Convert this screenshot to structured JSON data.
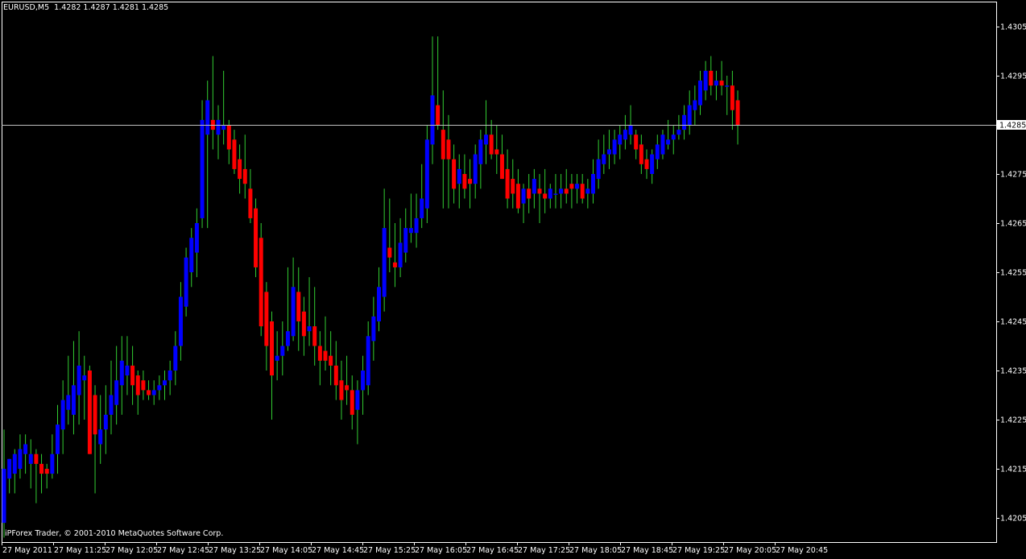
{
  "header": {
    "symbol": "EURUSD,M5",
    "ohlc": "1.4282 1.4287 1.4281 1.4285"
  },
  "footer": {
    "copyright": "iPForex Trader, © 2001-2010 MetaQuotes Software Corp."
  },
  "colors": {
    "background": "#000000",
    "axis": "#ffffff",
    "bull_body": "#0000ff",
    "bear_body": "#ff0000",
    "wick": "#32cd32",
    "price_line": "#c0c0c0"
  },
  "chart_data": {
    "type": "candlestick",
    "title": "EURUSD,M5",
    "y_ticks": [
      "1.4305",
      "1.4295",
      "1.4285",
      "1.4275",
      "1.4265",
      "1.4255",
      "1.4245",
      "1.4235",
      "1.4225",
      "1.4215",
      "1.4205"
    ],
    "x_ticks": [
      "27 May 2011",
      "27 May 11:25",
      "27 May 12:05",
      "27 May 12:45",
      "27 May 13:25",
      "27 May 14:05",
      "27 May 14:45",
      "27 May 15:25",
      "27 May 16:05",
      "27 May 16:45",
      "27 May 17:25",
      "27 May 18:05",
      "27 May 18:45",
      "27 May 19:25",
      "27 May 20:05",
      "27 May 20:45"
    ],
    "current_price": "1.4285",
    "ylim": [
      1.42,
      1.431
    ],
    "candles": [
      {
        "o": 1.4204,
        "h": 1.4223,
        "l": 1.4201,
        "c": 1.4215
      },
      {
        "o": 1.4213,
        "h": 1.4217,
        "l": 1.421,
        "c": 1.4217
      },
      {
        "o": 1.4214,
        "h": 1.4219,
        "l": 1.421,
        "c": 1.4218
      },
      {
        "o": 1.4215,
        "h": 1.4222,
        "l": 1.4213,
        "c": 1.4219
      },
      {
        "o": 1.4218,
        "h": 1.4222,
        "l": 1.4214,
        "c": 1.422
      },
      {
        "o": 1.4216,
        "h": 1.4221,
        "l": 1.4211,
        "c": 1.4218
      },
      {
        "o": 1.4218,
        "h": 1.4219,
        "l": 1.4208,
        "c": 1.4216
      },
      {
        "o": 1.4216,
        "h": 1.4218,
        "l": 1.421,
        "c": 1.4214
      },
      {
        "o": 1.4215,
        "h": 1.4216,
        "l": 1.4211,
        "c": 1.4214
      },
      {
        "o": 1.4214,
        "h": 1.4222,
        "l": 1.4213,
        "c": 1.4218
      },
      {
        "o": 1.4218,
        "h": 1.4228,
        "l": 1.4214,
        "c": 1.4224
      },
      {
        "o": 1.4223,
        "h": 1.4233,
        "l": 1.4218,
        "c": 1.4229
      },
      {
        "o": 1.4227,
        "h": 1.4238,
        "l": 1.4224,
        "c": 1.423
      },
      {
        "o": 1.4226,
        "h": 1.4241,
        "l": 1.4222,
        "c": 1.4232
      },
      {
        "o": 1.423,
        "h": 1.4243,
        "l": 1.4224,
        "c": 1.4236
      },
      {
        "o": 1.4233,
        "h": 1.4238,
        "l": 1.4225,
        "c": 1.4234
      },
      {
        "o": 1.4235,
        "h": 1.4236,
        "l": 1.4218,
        "c": 1.4218
      },
      {
        "o": 1.423,
        "h": 1.4232,
        "l": 1.421,
        "c": 1.4222
      },
      {
        "o": 1.422,
        "h": 1.423,
        "l": 1.4216,
        "c": 1.4223
      },
      {
        "o": 1.4223,
        "h": 1.4232,
        "l": 1.4218,
        "c": 1.4226
      },
      {
        "o": 1.4226,
        "h": 1.4237,
        "l": 1.4222,
        "c": 1.423
      },
      {
        "o": 1.4228,
        "h": 1.424,
        "l": 1.4224,
        "c": 1.4233
      },
      {
        "o": 1.4232,
        "h": 1.4242,
        "l": 1.4226,
        "c": 1.4237
      },
      {
        "o": 1.4234,
        "h": 1.4242,
        "l": 1.423,
        "c": 1.4236
      },
      {
        "o": 1.4236,
        "h": 1.424,
        "l": 1.4228,
        "c": 1.4232
      },
      {
        "o": 1.4234,
        "h": 1.4235,
        "l": 1.4226,
        "c": 1.423
      },
      {
        "o": 1.4233,
        "h": 1.4235,
        "l": 1.4229,
        "c": 1.4231
      },
      {
        "o": 1.4231,
        "h": 1.4233,
        "l": 1.4229,
        "c": 1.423
      },
      {
        "o": 1.423,
        "h": 1.4233,
        "l": 1.4228,
        "c": 1.4231
      },
      {
        "o": 1.4231,
        "h": 1.4234,
        "l": 1.4229,
        "c": 1.4232
      },
      {
        "o": 1.4232,
        "h": 1.4235,
        "l": 1.4229,
        "c": 1.4233
      },
      {
        "o": 1.4233,
        "h": 1.4237,
        "l": 1.423,
        "c": 1.4235
      },
      {
        "o": 1.4235,
        "h": 1.4243,
        "l": 1.4232,
        "c": 1.424
      },
      {
        "o": 1.424,
        "h": 1.4253,
        "l": 1.4237,
        "c": 1.425
      },
      {
        "o": 1.4248,
        "h": 1.426,
        "l": 1.4246,
        "c": 1.4258
      },
      {
        "o": 1.4255,
        "h": 1.4264,
        "l": 1.4252,
        "c": 1.4262
      },
      {
        "o": 1.4259,
        "h": 1.4268,
        "l": 1.4254,
        "c": 1.4265
      },
      {
        "o": 1.4266,
        "h": 1.429,
        "l": 1.4264,
        "c": 1.4286
      },
      {
        "o": 1.4283,
        "h": 1.4294,
        "l": 1.4264,
        "c": 1.429
      },
      {
        "o": 1.4286,
        "h": 1.4299,
        "l": 1.428,
        "c": 1.4284
      },
      {
        "o": 1.4283,
        "h": 1.4289,
        "l": 1.4278,
        "c": 1.4286
      },
      {
        "o": 1.4284,
        "h": 1.4296,
        "l": 1.4281,
        "c": 1.4285
      },
      {
        "o": 1.4285,
        "h": 1.4286,
        "l": 1.4277,
        "c": 1.428
      },
      {
        "o": 1.4282,
        "h": 1.4284,
        "l": 1.4275,
        "c": 1.4276
      },
      {
        "o": 1.4278,
        "h": 1.4281,
        "l": 1.4271,
        "c": 1.4274
      },
      {
        "o": 1.4276,
        "h": 1.4283,
        "l": 1.427,
        "c": 1.4273
      },
      {
        "o": 1.4272,
        "h": 1.4276,
        "l": 1.4265,
        "c": 1.4266
      },
      {
        "o": 1.4268,
        "h": 1.427,
        "l": 1.4254,
        "c": 1.4256
      },
      {
        "o": 1.4262,
        "h": 1.4265,
        "l": 1.4242,
        "c": 1.4244
      },
      {
        "o": 1.4251,
        "h": 1.4253,
        "l": 1.4235,
        "c": 1.424
      },
      {
        "o": 1.4245,
        "h": 1.4247,
        "l": 1.4225,
        "c": 1.4234
      },
      {
        "o": 1.4237,
        "h": 1.4243,
        "l": 1.4233,
        "c": 1.4238
      },
      {
        "o": 1.4238,
        "h": 1.4245,
        "l": 1.4234,
        "c": 1.424
      },
      {
        "o": 1.424,
        "h": 1.4256,
        "l": 1.4239,
        "c": 1.4243
      },
      {
        "o": 1.4242,
        "h": 1.4258,
        "l": 1.4241,
        "c": 1.4252
      },
      {
        "o": 1.4251,
        "h": 1.4256,
        "l": 1.4239,
        "c": 1.4245
      },
      {
        "o": 1.4247,
        "h": 1.425,
        "l": 1.4238,
        "c": 1.4242
      },
      {
        "o": 1.4243,
        "h": 1.4254,
        "l": 1.424,
        "c": 1.4244
      },
      {
        "o": 1.4244,
        "h": 1.4252,
        "l": 1.4236,
        "c": 1.424
      },
      {
        "o": 1.424,
        "h": 1.4243,
        "l": 1.4232,
        "c": 1.4237
      },
      {
        "o": 1.4239,
        "h": 1.4246,
        "l": 1.4235,
        "c": 1.4237
      },
      {
        "o": 1.4238,
        "h": 1.4243,
        "l": 1.4232,
        "c": 1.4236
      },
      {
        "o": 1.4236,
        "h": 1.4241,
        "l": 1.4229,
        "c": 1.4232
      },
      {
        "o": 1.4233,
        "h": 1.4237,
        "l": 1.4225,
        "c": 1.4229
      },
      {
        "o": 1.4232,
        "h": 1.4238,
        "l": 1.4228,
        "c": 1.4231
      },
      {
        "o": 1.4231,
        "h": 1.4234,
        "l": 1.4223,
        "c": 1.4226
      },
      {
        "o": 1.4227,
        "h": 1.4233,
        "l": 1.422,
        "c": 1.4231
      },
      {
        "o": 1.4231,
        "h": 1.4238,
        "l": 1.4226,
        "c": 1.4235
      },
      {
        "o": 1.4232,
        "h": 1.4245,
        "l": 1.423,
        "c": 1.4242
      },
      {
        "o": 1.4241,
        "h": 1.425,
        "l": 1.4237,
        "c": 1.4246
      },
      {
        "o": 1.4245,
        "h": 1.4256,
        "l": 1.4243,
        "c": 1.4252
      },
      {
        "o": 1.425,
        "h": 1.4272,
        "l": 1.4247,
        "c": 1.4264
      },
      {
        "o": 1.426,
        "h": 1.427,
        "l": 1.4255,
        "c": 1.4258
      },
      {
        "o": 1.4257,
        "h": 1.4265,
        "l": 1.4252,
        "c": 1.4256
      },
      {
        "o": 1.4256,
        "h": 1.4266,
        "l": 1.4254,
        "c": 1.4261
      },
      {
        "o": 1.4259,
        "h": 1.4268,
        "l": 1.4257,
        "c": 1.4264
      },
      {
        "o": 1.4263,
        "h": 1.4271,
        "l": 1.4261,
        "c": 1.4264
      },
      {
        "o": 1.4263,
        "h": 1.4271,
        "l": 1.426,
        "c": 1.4266
      },
      {
        "o": 1.4266,
        "h": 1.4277,
        "l": 1.4264,
        "c": 1.427
      },
      {
        "o": 1.4268,
        "h": 1.4285,
        "l": 1.4265,
        "c": 1.4282
      },
      {
        "o": 1.4281,
        "h": 1.4303,
        "l": 1.4277,
        "c": 1.4291
      },
      {
        "o": 1.4289,
        "h": 1.4303,
        "l": 1.4284,
        "c": 1.4285
      },
      {
        "o": 1.4284,
        "h": 1.4292,
        "l": 1.4268,
        "c": 1.4278
      },
      {
        "o": 1.4282,
        "h": 1.4287,
        "l": 1.4268,
        "c": 1.4278
      },
      {
        "o": 1.4278,
        "h": 1.4281,
        "l": 1.4269,
        "c": 1.4272
      },
      {
        "o": 1.4273,
        "h": 1.4279,
        "l": 1.4268,
        "c": 1.4276
      },
      {
        "o": 1.4275,
        "h": 1.4279,
        "l": 1.427,
        "c": 1.4272
      },
      {
        "o": 1.4274,
        "h": 1.4278,
        "l": 1.4268,
        "c": 1.4273
      },
      {
        "o": 1.4273,
        "h": 1.4281,
        "l": 1.427,
        "c": 1.4279
      },
      {
        "o": 1.4277,
        "h": 1.4284,
        "l": 1.4272,
        "c": 1.4282
      },
      {
        "o": 1.4281,
        "h": 1.429,
        "l": 1.4277,
        "c": 1.4283
      },
      {
        "o": 1.4283,
        "h": 1.4286,
        "l": 1.4278,
        "c": 1.4279
      },
      {
        "o": 1.428,
        "h": 1.4285,
        "l": 1.4275,
        "c": 1.4279
      },
      {
        "o": 1.4279,
        "h": 1.4283,
        "l": 1.4274,
        "c": 1.4274
      },
      {
        "o": 1.4276,
        "h": 1.428,
        "l": 1.4268,
        "c": 1.427
      },
      {
        "o": 1.4274,
        "h": 1.4278,
        "l": 1.4268,
        "c": 1.4271
      },
      {
        "o": 1.4273,
        "h": 1.4276,
        "l": 1.4267,
        "c": 1.4268
      },
      {
        "o": 1.4269,
        "h": 1.4273,
        "l": 1.4265,
        "c": 1.4272
      },
      {
        "o": 1.4272,
        "h": 1.4275,
        "l": 1.4267,
        "c": 1.427
      },
      {
        "o": 1.4271,
        "h": 1.4276,
        "l": 1.4268,
        "c": 1.4274
      },
      {
        "o": 1.4272,
        "h": 1.4275,
        "l": 1.4265,
        "c": 1.4271
      },
      {
        "o": 1.4271,
        "h": 1.4276,
        "l": 1.4267,
        "c": 1.427
      },
      {
        "o": 1.427,
        "h": 1.4273,
        "l": 1.4268,
        "c": 1.4272
      },
      {
        "o": 1.4271,
        "h": 1.4275,
        "l": 1.4268,
        "c": 1.4271
      },
      {
        "o": 1.4271,
        "h": 1.4275,
        "l": 1.4268,
        "c": 1.4272
      },
      {
        "o": 1.4272,
        "h": 1.4276,
        "l": 1.4269,
        "c": 1.4271
      },
      {
        "o": 1.4273,
        "h": 1.4275,
        "l": 1.4268,
        "c": 1.4272
      },
      {
        "o": 1.4272,
        "h": 1.4275,
        "l": 1.4269,
        "c": 1.4273
      },
      {
        "o": 1.4273,
        "h": 1.4275,
        "l": 1.4269,
        "c": 1.427
      },
      {
        "o": 1.4271,
        "h": 1.4274,
        "l": 1.4268,
        "c": 1.4272
      },
      {
        "o": 1.4271,
        "h": 1.4278,
        "l": 1.4269,
        "c": 1.4275
      },
      {
        "o": 1.4274,
        "h": 1.4282,
        "l": 1.4272,
        "c": 1.4278
      },
      {
        "o": 1.4277,
        "h": 1.4283,
        "l": 1.4275,
        "c": 1.4279
      },
      {
        "o": 1.4279,
        "h": 1.4284,
        "l": 1.4276,
        "c": 1.428
      },
      {
        "o": 1.4279,
        "h": 1.4284,
        "l": 1.4277,
        "c": 1.4282
      },
      {
        "o": 1.4281,
        "h": 1.4285,
        "l": 1.4278,
        "c": 1.4283
      },
      {
        "o": 1.4282,
        "h": 1.4287,
        "l": 1.428,
        "c": 1.4284
      },
      {
        "o": 1.4283,
        "h": 1.4289,
        "l": 1.4281,
        "c": 1.4285
      },
      {
        "o": 1.4283,
        "h": 1.4284,
        "l": 1.4278,
        "c": 1.428
      },
      {
        "o": 1.4281,
        "h": 1.4283,
        "l": 1.4275,
        "c": 1.4277
      },
      {
        "o": 1.4278,
        "h": 1.428,
        "l": 1.4274,
        "c": 1.4276
      },
      {
        "o": 1.4275,
        "h": 1.428,
        "l": 1.4273,
        "c": 1.4279
      },
      {
        "o": 1.4278,
        "h": 1.4283,
        "l": 1.4276,
        "c": 1.4281
      },
      {
        "o": 1.4279,
        "h": 1.4284,
        "l": 1.4278,
        "c": 1.4283
      },
      {
        "o": 1.4281,
        "h": 1.4286,
        "l": 1.428,
        "c": 1.4282
      },
      {
        "o": 1.4282,
        "h": 1.4285,
        "l": 1.4279,
        "c": 1.4283
      },
      {
        "o": 1.4283,
        "h": 1.4287,
        "l": 1.4282,
        "c": 1.4284
      },
      {
        "o": 1.4284,
        "h": 1.4289,
        "l": 1.4282,
        "c": 1.4287
      },
      {
        "o": 1.4285,
        "h": 1.4292,
        "l": 1.4283,
        "c": 1.4289
      },
      {
        "o": 1.4288,
        "h": 1.4293,
        "l": 1.4285,
        "c": 1.429
      },
      {
        "o": 1.4289,
        "h": 1.4296,
        "l": 1.4287,
        "c": 1.4294
      },
      {
        "o": 1.4292,
        "h": 1.4298,
        "l": 1.429,
        "c": 1.4296
      },
      {
        "o": 1.4296,
        "h": 1.4299,
        "l": 1.4291,
        "c": 1.4293
      },
      {
        "o": 1.4293,
        "h": 1.4296,
        "l": 1.429,
        "c": 1.4294
      },
      {
        "o": 1.4294,
        "h": 1.4298,
        "l": 1.4291,
        "c": 1.4293
      },
      {
        "o": 1.4293,
        "h": 1.4295,
        "l": 1.4287,
        "c": 1.4293
      },
      {
        "o": 1.4293,
        "h": 1.4296,
        "l": 1.4284,
        "c": 1.4288
      },
      {
        "o": 1.429,
        "h": 1.4292,
        "l": 1.4281,
        "c": 1.4285
      }
    ]
  }
}
